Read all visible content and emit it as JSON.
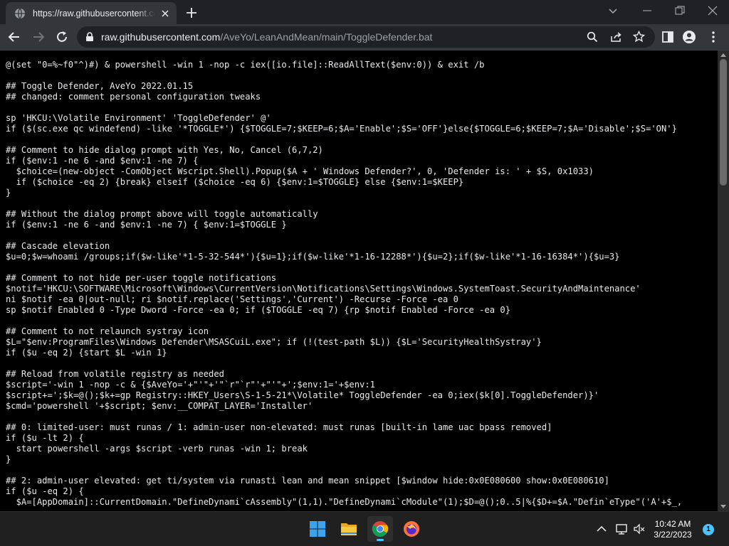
{
  "browser": {
    "tab": {
      "title": "https://raw.githubusercontent.com/AveYo/LeanAndMean/main/ToggleDefender.bat"
    },
    "address_bar": {
      "host": "raw.githubusercontent.com",
      "path": "/AveYo/LeanAndMean/main/ToggleDefender.bat"
    },
    "colors": {
      "accent": "#8ab4f8",
      "tab_bg": "#35363a",
      "frame_bg": "#202124"
    }
  },
  "page": {
    "lines": [
      "@(set \"0=%~f0\"^)#) & powershell -win 1 -nop -c iex([io.file]::ReadAllText($env:0)) & exit /b",
      "",
      "## Toggle Defender, AveYo 2022.01.15",
      "## changed: comment personal configuration tweaks",
      "",
      "sp 'HKCU:\\Volatile Environment' 'ToggleDefender' @'",
      "if ($(sc.exe qc windefend) -like '*TOGGLE*') {$TOGGLE=7;$KEEP=6;$A='Enable';$S='OFF'}else{$TOGGLE=6;$KEEP=7;$A='Disable';$S='ON'}",
      "",
      "## Comment to hide dialog prompt with Yes, No, Cancel (6,7,2)",
      "if ($env:1 -ne 6 -and $env:1 -ne 7) {",
      "  $choice=(new-object -ComObject Wscript.Shell).Popup($A + ' Windows Defender?', 0, 'Defender is: ' + $S, 0x1033)",
      "  if ($choice -eq 2) {break} elseif ($choice -eq 6) {$env:1=$TOGGLE} else {$env:1=$KEEP}",
      "}",
      "",
      "## Without the dialog prompt above will toggle automatically",
      "if ($env:1 -ne 6 -and $env:1 -ne 7) { $env:1=$TOGGLE }",
      "",
      "## Cascade elevation",
      "$u=0;$w=whoami /groups;if($w-like'*1-5-32-544*'){$u=1};if($w-like'*1-16-12288*'){$u=2};if($w-like'*1-16-16384*'){$u=3}",
      "",
      "## Comment to not hide per-user toggle notifications",
      "$notif='HKCU:\\SOFTWARE\\Microsoft\\Windows\\CurrentVersion\\Notifications\\Settings\\Windows.SystemToast.SecurityAndMaintenance'",
      "ni $notif -ea 0|out-null; ri $notif.replace('Settings','Current') -Recurse -Force -ea 0",
      "sp $notif Enabled 0 -Type Dword -Force -ea 0; if ($TOGGLE -eq 7) {rp $notif Enabled -Force -ea 0}",
      "",
      "## Comment to not relaunch systray icon",
      "$L=\"$env:ProgramFiles\\Windows Defender\\MSASCuiL.exe\"; if (!(test-path $L)) {$L='SecurityHealthSystray'}",
      "if ($u -eq 2) {start $L -win 1}",
      "",
      "## Reload from volatile registry as needed",
      "$script='-win 1 -nop -c & {$AveYo='+\"'\"+'\"`r\"`r\"'+\"'\"+';$env:1='+$env:1",
      "$script+=';$k=@();$k+=gp Registry::HKEY_Users\\S-1-5-21*\\Volatile* ToggleDefender -ea 0;iex($k[0].ToggleDefender)}'",
      "$cmd='powershell '+$script; $env:__COMPAT_LAYER='Installer'",
      "",
      "## 0: limited-user: must runas / 1: admin-user non-elevated: must runas [built-in lame uac bpass removed]",
      "if ($u -lt 2) {",
      "  start powershell -args $script -verb runas -win 1; break",
      "}",
      "",
      "## 2: admin-user elevated: get ti/system via runasti lean and mean snippet [$window hide:0x0E080600 show:0x0E080610]",
      "if ($u -eq 2) {",
      "  $A=[AppDomain]::CurrentDomain.\"DefineDynami`cAssembly\"(1,1).\"DefineDynami`cModule\"(1);$D=@();0..5|%{$D+=$A.\"Defin`eType\"('A'+$_,"
    ]
  },
  "taskbar": {
    "apps": [
      "windows-start",
      "file-explorer",
      "google-chrome",
      "firefox"
    ],
    "clock": {
      "time": "10:42 AM",
      "date": "3/22/2023"
    },
    "notification_count": "1"
  }
}
